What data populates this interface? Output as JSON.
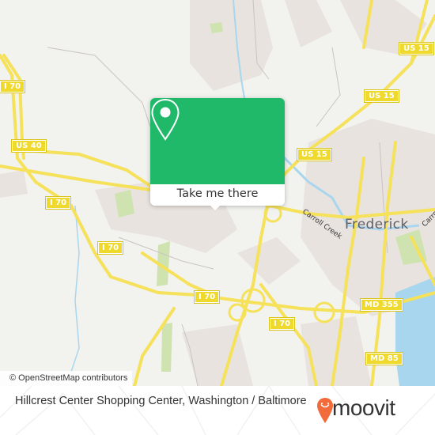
{
  "map": {
    "city_label": "Frederick",
    "water_labels": [
      "Carroll Creek",
      "Carroll"
    ],
    "route_shields": [
      {
        "id": "us15-a",
        "label": "US 15"
      },
      {
        "id": "us15-b",
        "label": "US 15"
      },
      {
        "id": "us15-c",
        "label": "US 15"
      },
      {
        "id": "i70-a",
        "label": "I 70"
      },
      {
        "id": "us40",
        "label": "US 40"
      },
      {
        "id": "i70-b",
        "label": "I 70"
      },
      {
        "id": "i70-c",
        "label": "I 70"
      },
      {
        "id": "i70-d",
        "label": "I 70"
      },
      {
        "id": "i70-e",
        "label": "I 70"
      },
      {
        "id": "i70-f",
        "label": "I 70"
      },
      {
        "id": "md355",
        "label": "MD 355"
      },
      {
        "id": "md85",
        "label": "MD 85"
      }
    ],
    "attribution": "© OpenStreetMap contributors",
    "colors": {
      "road": "#f5e15a",
      "water": "#a9d6ef",
      "park": "#cfe3b0",
      "land": "#f2f2ee",
      "urban": "#e9e3df"
    }
  },
  "popup": {
    "icon": "map-pin-icon",
    "button_label": "Take me there",
    "color": "#20b96a"
  },
  "footer": {
    "place_name": "Hillcrest Center Shopping Center, Washington / Baltimore",
    "brand": "moovit",
    "brand_color": "#f26b3a"
  }
}
